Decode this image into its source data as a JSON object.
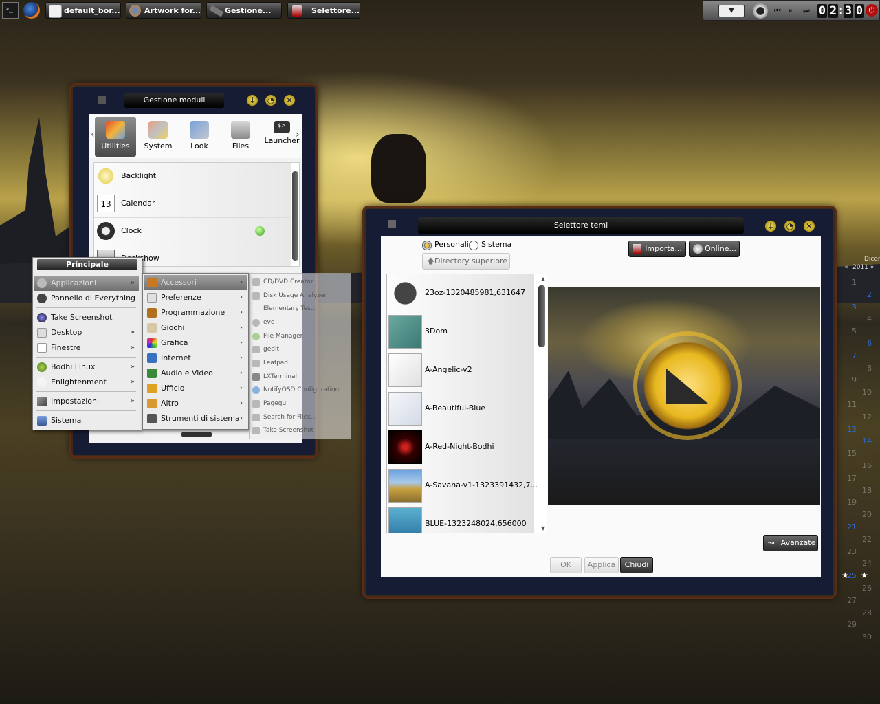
{
  "taskbar": {
    "items": [
      {
        "label": "default_bor..."
      },
      {
        "label": "Artwork for..."
      },
      {
        "label": "Gestione..."
      },
      {
        "label": "Selettore..."
      }
    ],
    "clock": {
      "h1": "0",
      "h2": "2",
      "sep": ":",
      "m1": "3",
      "m2": "0"
    }
  },
  "module_window": {
    "title": "Gestione moduli",
    "categories": [
      {
        "label": "Utilities",
        "icon": "utilities-icon"
      },
      {
        "label": "System",
        "icon": "system-icon"
      },
      {
        "label": "Look",
        "icon": "look-icon"
      },
      {
        "label": "Files",
        "icon": "files-icon"
      },
      {
        "label": "Launcher",
        "icon": "launcher-icon",
        "badge": "$>"
      }
    ],
    "modules": [
      {
        "label": "Backlight",
        "icon": "lightbulb-icon"
      },
      {
        "label": "Calendar",
        "icon": "calendar-icon",
        "badge": "13"
      },
      {
        "label": "Clock",
        "icon": "clock-icon"
      },
      {
        "label": "Deskshow",
        "icon": "desktop-icon"
      }
    ]
  },
  "main_menu": {
    "title": "Principale",
    "items": [
      {
        "label": "Applicazioni",
        "icon": "gear-icon"
      },
      {
        "label": "Pannello di Everything",
        "icon": "gear-icon"
      },
      {
        "label": "Take Screenshot",
        "icon": "camera-icon"
      },
      {
        "label": "Desktop",
        "icon": "desktop-icon"
      },
      {
        "label": "Finestre",
        "icon": "window-icon"
      },
      {
        "label": "Bodhi Linux",
        "icon": "bodhi-icon"
      },
      {
        "label": "Enlightenment",
        "icon": "e-icon"
      },
      {
        "label": "Impostazioni",
        "icon": "settings-icon"
      },
      {
        "label": "Sistema",
        "icon": "computer-icon"
      }
    ]
  },
  "apps_menu": {
    "items": [
      {
        "label": "Accessori",
        "color": "#c8781e"
      },
      {
        "label": "Preferenze",
        "color": "#e0e0e0"
      },
      {
        "label": "Programmazione",
        "color": "#b0701c"
      },
      {
        "label": "Giochi",
        "color": "#d8c8a8"
      },
      {
        "label": "Grafica",
        "color": "#c84ac8"
      },
      {
        "label": "Internet",
        "color": "#3a70c0"
      },
      {
        "label": "Audio e Video",
        "color": "#3a8a3a"
      },
      {
        "label": "Ufficio",
        "color": "#e0a020"
      },
      {
        "label": "Altro",
        "color": "#d89a30"
      },
      {
        "label": "Strumenti di sistema",
        "color": "#555555"
      }
    ]
  },
  "accessories_menu": {
    "items": [
      {
        "label": "CD/DVD Creator"
      },
      {
        "label": "Disk Usage Analyzer"
      },
      {
        "label": "Elementary Tes..."
      },
      {
        "label": "eve"
      },
      {
        "label": "File Manager"
      },
      {
        "label": "gedit"
      },
      {
        "label": "Leafpad"
      },
      {
        "label": "LXTerminal"
      },
      {
        "label": "NotifyOSD Configuration"
      },
      {
        "label": "Pagegu"
      },
      {
        "label": "Search for Files..."
      },
      {
        "label": "Take Screenshot"
      }
    ]
  },
  "theme_window": {
    "title": "Selettore temi",
    "radio_personali": "Personali",
    "radio_sistema": "Sistema",
    "parent_dir": "Directory superiore",
    "import_btn": "Importa...",
    "online_btn": "Online...",
    "themes": [
      {
        "label": "23oz-1320485981,631647"
      },
      {
        "label": "3Dom"
      },
      {
        "label": "A-Angelic-v2"
      },
      {
        "label": "A-Beautiful-Blue"
      },
      {
        "label": "A-Red-Night-Bodhi"
      },
      {
        "label": "A-Savana-v1-1323391432,7..."
      },
      {
        "label": "BLUE-1323248024,656000"
      }
    ],
    "advanced_btn": "Avanzate",
    "ok_btn": "OK",
    "apply_btn": "Applica",
    "close_btn": "Chiudi"
  },
  "calendar": {
    "month": "Dicer",
    "year": "2011",
    "days": [
      "1",
      "2",
      "3",
      "4",
      "5",
      "6",
      "7",
      "8",
      "9",
      "10",
      "11",
      "12",
      "13",
      "14",
      "15",
      "16",
      "17",
      "18",
      "19",
      "20",
      "21",
      "22",
      "23",
      "24",
      "25",
      "26",
      "27",
      "28",
      "29",
      "30"
    ]
  },
  "colors": {
    "accent_yellow": "#e8c830",
    "frame_dark": "#161c33",
    "frame_copper": "#5a2c16",
    "blue_day": "#2a6ad8"
  }
}
